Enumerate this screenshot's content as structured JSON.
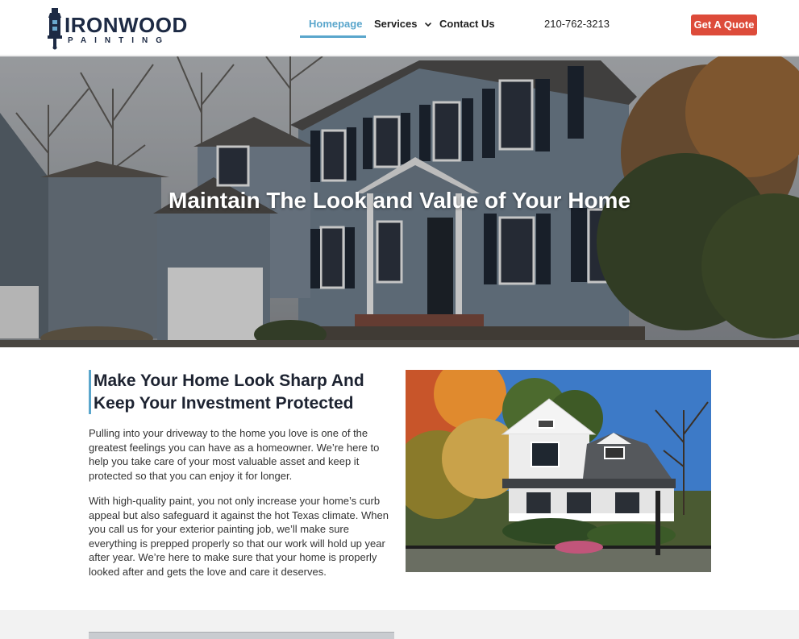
{
  "brand": {
    "name_main": "IRONWOOD",
    "name_sub": "PAINTING",
    "colors": {
      "navy": "#1d2a44",
      "accent": "#5aa6cc",
      "cta": "#dd4b3a"
    }
  },
  "nav": {
    "items": [
      {
        "label": "Homepage",
        "active": true
      },
      {
        "label": "Services",
        "has_dropdown": true
      },
      {
        "label": "Contact Us"
      }
    ]
  },
  "header": {
    "phone": "210-762-3213",
    "cta_label": "Get A Quote"
  },
  "hero": {
    "title": "Maintain The Look and Value of Your Home"
  },
  "intro": {
    "heading": "Make Your Home Look Sharp And Keep Your Investment Protected",
    "paragraphs": [
      "Pulling into your driveway to the home you love is one of the greatest feelings you can have as a homeowner. We’re here to help you take care of your most valuable asset and keep it protected so that you can enjoy it for longer.",
      "With high-quality paint, you not only increase your home’s curb appeal but also safeguard it against the hot Texas climate. When you call us for your exterior painting job, we’ll make sure everything is prepped properly so that our work will hold up year after year. We’re here to make sure that your home is properly looked after and gets the love and care it deserves."
    ]
  },
  "icons": [
    "chevron-down-icon",
    "paintbrush-lighthouse-logo-icon"
  ]
}
